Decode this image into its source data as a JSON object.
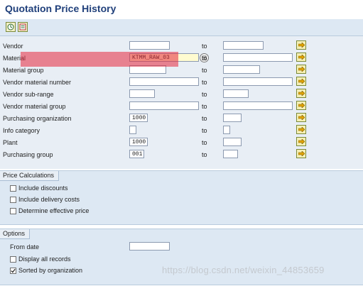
{
  "window": {
    "title": "Quotation Price History"
  },
  "toolbar": {
    "buttons": [
      {
        "name": "execute",
        "icon": "execute-clock-icon"
      },
      {
        "name": "get-variant",
        "icon": "variant-list-icon"
      }
    ]
  },
  "selection": {
    "to_label": "to",
    "rows": [
      {
        "label": "Vendor",
        "low": "",
        "high": ""
      },
      {
        "label": "Material",
        "low": "KTMM_RAW_03",
        "high": ""
      },
      {
        "label": "Material group",
        "low": "",
        "high": ""
      },
      {
        "label": "Vendor material number",
        "low": "",
        "high": ""
      },
      {
        "label": "Vendor sub-range",
        "low": "",
        "high": ""
      },
      {
        "label": "Vendor material group",
        "low": "",
        "high": ""
      },
      {
        "label": "Purchasing organization",
        "low": "1000",
        "high": ""
      },
      {
        "label": "Info category",
        "low": "",
        "high": ""
      },
      {
        "label": "Plant",
        "low": "1000",
        "high": ""
      },
      {
        "label": "Purchasing group",
        "low": "001",
        "high": ""
      }
    ],
    "multiple_selection_icon": "arrow-right-icon",
    "highlight_color": "#e6283c"
  },
  "price_calculations": {
    "title": "Price Calculations",
    "options": [
      {
        "label": "Include discounts",
        "checked": false
      },
      {
        "label": "Include delivery costs",
        "checked": false
      },
      {
        "label": "Determine effective price",
        "checked": false
      }
    ]
  },
  "options": {
    "title": "Options",
    "from_date_label": "From date",
    "from_date_value": "",
    "checks": [
      {
        "label": "Display all records",
        "checked": false
      },
      {
        "label": "Sorted by organization",
        "checked": true
      }
    ]
  },
  "watermark": "https://blog.csdn.net/weixin_44853659",
  "colors": {
    "title": "#1f3f7a",
    "group_bg": "#dde8f3",
    "field_focus": "#fffbd0"
  }
}
